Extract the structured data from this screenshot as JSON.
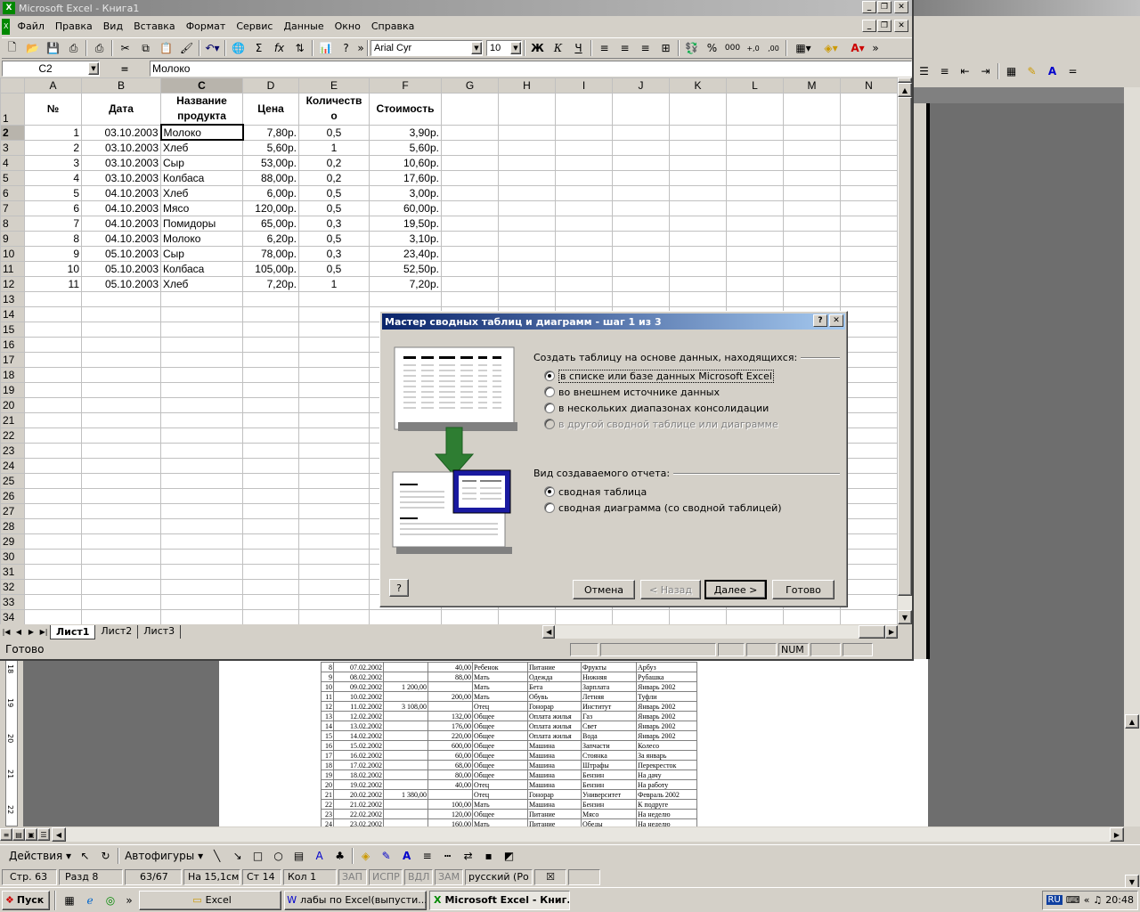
{
  "background_window": {
    "right_buttons": [
      "_",
      "❐",
      "✕"
    ]
  },
  "excel": {
    "title": "Microsoft Excel - Книга1",
    "menu": [
      "Файл",
      "Правка",
      "Вид",
      "Вставка",
      "Формат",
      "Сервис",
      "Данные",
      "Окно",
      "Справка"
    ],
    "font_name": "Arial Cyr",
    "font_size": "10",
    "name_box": "C2",
    "formula_eq": "=",
    "formula_value": "Молоко",
    "columns": [
      "A",
      "B",
      "C",
      "D",
      "E",
      "F",
      "G",
      "H",
      "I",
      "J",
      "K",
      "L",
      "M",
      "N"
    ],
    "header_row": {
      "num": "1",
      "a": "№",
      "b": "Дата",
      "c1": "Название",
      "c2": "продукта",
      "d": "Цена",
      "e1": "Количеств",
      "e2": "о",
      "f": "Стоимость"
    },
    "rows": [
      {
        "n": "2",
        "a": "1",
        "b": "03.10.2003",
        "c": "Молоко",
        "d": "7,80р.",
        "e": "0,5",
        "f": "3,90р."
      },
      {
        "n": "3",
        "a": "2",
        "b": "03.10.2003",
        "c": "Хлеб",
        "d": "5,60р.",
        "e": "1",
        "f": "5,60р."
      },
      {
        "n": "4",
        "a": "3",
        "b": "03.10.2003",
        "c": "Сыр",
        "d": "53,00р.",
        "e": "0,2",
        "f": "10,60р."
      },
      {
        "n": "5",
        "a": "4",
        "b": "03.10.2003",
        "c": "Колбаса",
        "d": "88,00р.",
        "e": "0,2",
        "f": "17,60р."
      },
      {
        "n": "6",
        "a": "5",
        "b": "04.10.2003",
        "c": "Хлеб",
        "d": "6,00р.",
        "e": "0,5",
        "f": "3,00р."
      },
      {
        "n": "7",
        "a": "6",
        "b": "04.10.2003",
        "c": "Мясо",
        "d": "120,00р.",
        "e": "0,5",
        "f": "60,00р."
      },
      {
        "n": "8",
        "a": "7",
        "b": "04.10.2003",
        "c": "Помидоры",
        "d": "65,00р.",
        "e": "0,3",
        "f": "19,50р."
      },
      {
        "n": "9",
        "a": "8",
        "b": "04.10.2003",
        "c": "Молоко",
        "d": "6,20р.",
        "e": "0,5",
        "f": "3,10р."
      },
      {
        "n": "10",
        "a": "9",
        "b": "05.10.2003",
        "c": "Сыр",
        "d": "78,00р.",
        "e": "0,3",
        "f": "23,40р."
      },
      {
        "n": "11",
        "a": "10",
        "b": "05.10.2003",
        "c": "Колбаса",
        "d": "105,00р.",
        "e": "0,5",
        "f": "52,50р."
      },
      {
        "n": "12",
        "a": "11",
        "b": "05.10.2003",
        "c": "Хлеб",
        "d": "7,20р.",
        "e": "1",
        "f": "7,20р."
      }
    ],
    "empty_rows": [
      "13",
      "14",
      "15",
      "16",
      "17",
      "18",
      "19",
      "20",
      "21",
      "22",
      "23",
      "24",
      "25",
      "26",
      "27",
      "28",
      "29",
      "30",
      "31",
      "32",
      "33",
      "34"
    ],
    "sheet_tabs": [
      "Лист1",
      "Лист2",
      "Лист3"
    ],
    "status": "Готово",
    "status_num": "NUM"
  },
  "dialog": {
    "title": "Мастер сводных таблиц и диаграмм - шаг 1 из 3",
    "group1": "Создать таблицу на основе данных, находящихся:",
    "options1": [
      "в списке или базе данных Microsoft Excel",
      "во внешнем источнике данных",
      "в нескольких диапазонах консолидации",
      "в другой сводной таблице или диаграмме"
    ],
    "group2": "Вид создаваемого отчета:",
    "options2": [
      "сводная таблица",
      "сводная диаграмма (со сводной таблицей)"
    ],
    "buttons": {
      "cancel": "Отмена",
      "back": "< Назад",
      "next": "Далее >",
      "finish": "Готово"
    }
  },
  "word_doc": {
    "ruler": [
      "18",
      "19",
      "20",
      "21",
      "22"
    ],
    "rows": [
      [
        "8",
        "07.02.2002",
        "",
        "40,00",
        "Ребенок",
        "Питание",
        "Фрукты",
        "Арбуз"
      ],
      [
        "9",
        "08.02.2002",
        "",
        "88,00",
        "Мать",
        "Одежда",
        "Нижняя",
        "Рубашка"
      ],
      [
        "10",
        "09.02.2002",
        "1 200,00",
        "",
        "Мать",
        "Бета",
        "Зарплата",
        "Январь 2002"
      ],
      [
        "11",
        "10.02.2002",
        "",
        "200,00",
        "Мать",
        "Обувь",
        "Летняя",
        "Туфли"
      ],
      [
        "12",
        "11.02.2002",
        "3 108,00",
        "",
        "Отец",
        "Гонорар",
        "Институт",
        "Январь 2002"
      ],
      [
        "13",
        "12.02.2002",
        "",
        "132,00",
        "Общее",
        "Оплата жилья",
        "Газ",
        "Январь 2002"
      ],
      [
        "14",
        "13.02.2002",
        "",
        "176,00",
        "Общее",
        "Оплата жилья",
        "Свет",
        "Январь 2002"
      ],
      [
        "15",
        "14.02.2002",
        "",
        "220,00",
        "Общее",
        "Оплата жилья",
        "Вода",
        "Январь 2002"
      ],
      [
        "16",
        "15.02.2002",
        "",
        "600,00",
        "Общее",
        "Машина",
        "Запчасти",
        "Колесо"
      ],
      [
        "17",
        "16.02.2002",
        "",
        "60,00",
        "Общее",
        "Машина",
        "Стоянка",
        "За январь"
      ],
      [
        "18",
        "17.02.2002",
        "",
        "68,00",
        "Общее",
        "Машина",
        "Штрафы",
        "Перекресток"
      ],
      [
        "19",
        "18.02.2002",
        "",
        "80,00",
        "Общее",
        "Машина",
        "Бензин",
        "На дачу"
      ],
      [
        "20",
        "19.02.2002",
        "",
        "40,00",
        "Отец",
        "Машина",
        "Бензин",
        "На работу"
      ],
      [
        "21",
        "20.02.2002",
        "1 380,00",
        "",
        "Отец",
        "Гонорар",
        "Университет",
        "Февраль 2002"
      ],
      [
        "22",
        "21.02.2002",
        "",
        "100,00",
        "Мать",
        "Машина",
        "Бензин",
        "К подруге"
      ],
      [
        "23",
        "22.02.2002",
        "",
        "120,00",
        "Общее",
        "Питание",
        "Мясо",
        "На неделю"
      ],
      [
        "24",
        "23.02.2002",
        "",
        "160,00",
        "Мать",
        "Питание",
        "Обеды",
        "На неделю"
      ]
    ],
    "draw_bar": {
      "actions": "Действия",
      "autoshapes": "Автофигуры"
    },
    "status": {
      "page": "Стр. 63",
      "section": "Разд 8",
      "pages": "63/67",
      "at": "На 15,1см",
      "line": "Ст 14",
      "col": "Кол 1",
      "rec": "ЗАП",
      "track": "ИСПР",
      "ext": "ВДЛ",
      "ovr": "ЗАМ",
      "lang": "русский (Ро"
    }
  },
  "taskbar": {
    "start": "Пуск",
    "tasks": [
      "Excel",
      "лабы по Excel(выпусти...",
      "Microsoft Excel - Книг..."
    ],
    "lang": "RU",
    "time": "20:48"
  }
}
